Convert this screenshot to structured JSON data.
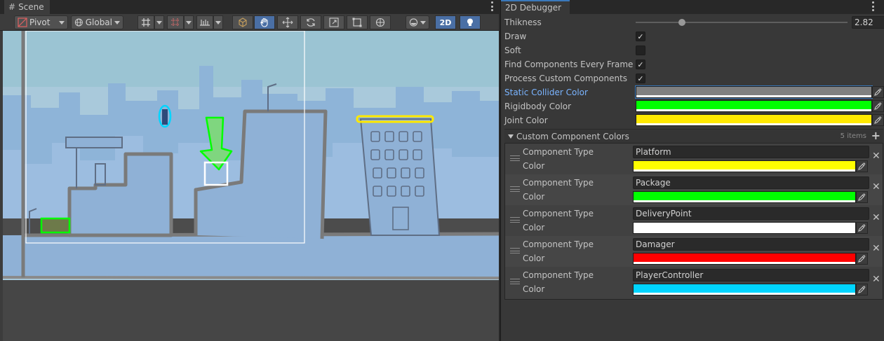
{
  "scene": {
    "tab_label": "Scene",
    "toolbar": {
      "pivot_label": "Pivot",
      "global_label": "Global",
      "mode_2d_label": "2D",
      "tool_icons": [
        "grid-snap-icon",
        "grid-icon",
        "ruler-icon",
        "cube-icon",
        "hand-icon",
        "move-icon",
        "rotate-icon",
        "scale-icon",
        "rect-icon",
        "transform-icon",
        "sphere-icon",
        "lightbulb-icon"
      ],
      "active_tool": "hand-icon"
    }
  },
  "inspector": {
    "tab_label": "2D Debugger",
    "thickness_label": "Thikness",
    "thickness_value": "2.82",
    "thickness_fraction": 0.21,
    "draw_label": "Draw",
    "draw_checked": true,
    "soft_label": "Soft",
    "soft_checked": false,
    "find_label": "Find Components Every Frame",
    "find_checked": true,
    "process_label": "Process Custom Components",
    "process_checked": true,
    "static_label": "Static Collider Color",
    "static_color": "#808080",
    "rigidbody_label": "Rigidbody Color",
    "rigidbody_color": "#00ff00",
    "joint_label": "Joint Color",
    "joint_color": "#ffe900",
    "custom_label": "Custom Component Colors",
    "custom_count": "5 items",
    "items": [
      {
        "type_label": "Component Type",
        "type_value": "Platform",
        "color_label": "Color",
        "color": "#ffff00"
      },
      {
        "type_label": "Component Type",
        "type_value": "Package",
        "color_label": "Color",
        "color": "#00ff00"
      },
      {
        "type_label": "Component Type",
        "type_value": "DeliveryPoint",
        "color_label": "Color",
        "color": "#ffffff"
      },
      {
        "type_label": "Component Type",
        "type_value": "Damager",
        "color_label": "Color",
        "color": "#ff0000"
      },
      {
        "type_label": "Component Type",
        "type_value": "PlayerController",
        "color_label": "Color",
        "color": "#00d5ff"
      }
    ]
  }
}
